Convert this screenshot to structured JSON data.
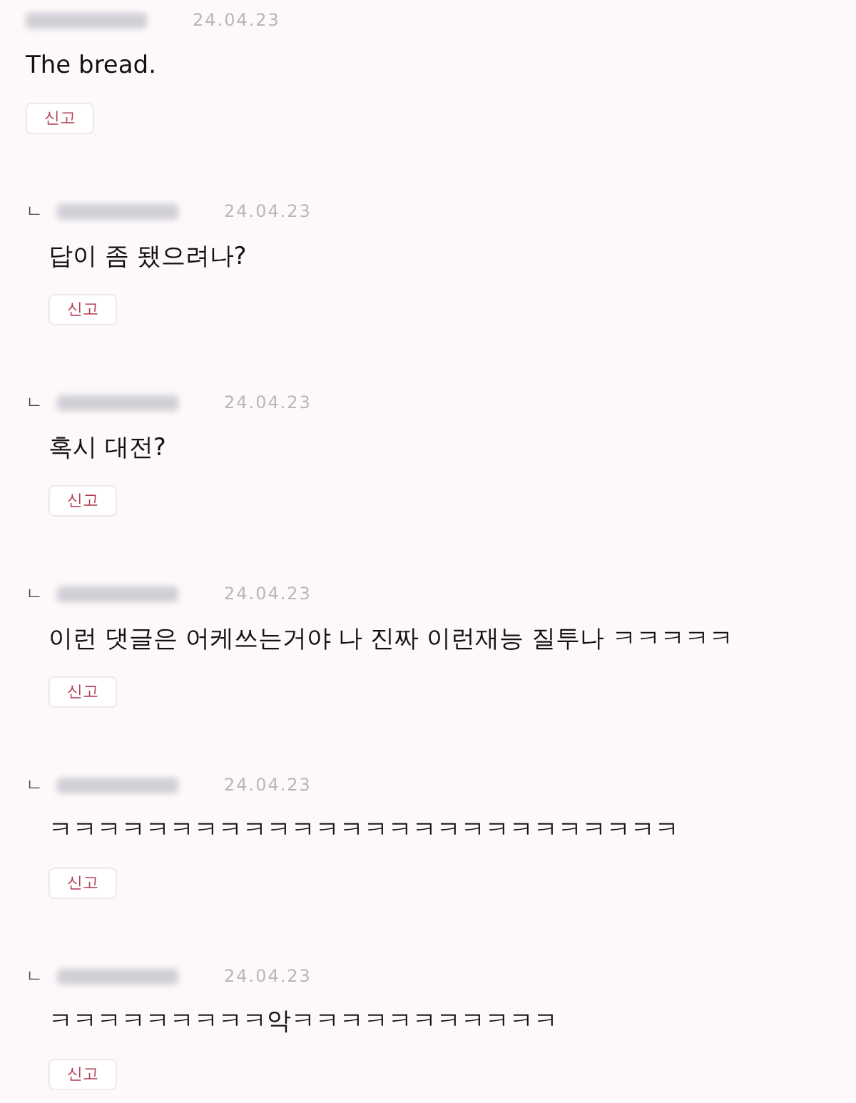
{
  "comments": [
    {
      "kind": "comment",
      "date": "24.04.23",
      "text": "The bread.",
      "report": "신고"
    },
    {
      "kind": "reply",
      "marker": "ㄴ",
      "date": "24.04.23",
      "text": "답이 좀 됐으려나?",
      "report": "신고"
    },
    {
      "kind": "reply",
      "marker": "ㄴ",
      "date": "24.04.23",
      "text": "혹시 대전?",
      "report": "신고"
    },
    {
      "kind": "reply",
      "marker": "ㄴ",
      "date": "24.04.23",
      "text": "이런 댓글은 어케쓰는거야 나 진짜 이런재능 질투나 ㅋㅋㅋㅋㅋ",
      "report": "신고"
    },
    {
      "kind": "reply",
      "marker": "ㄴ",
      "date": "24.04.23",
      "text": "ㅋㅋㅋㅋㅋㅋㅋㅋㅋㅋㅋㅋㅋㅋㅋㅋㅋㅋㅋㅋㅋㅋㅋㅋㅋㅋ",
      "report": "신고"
    },
    {
      "kind": "reply",
      "marker": "ㄴ",
      "date": "24.04.23",
      "text": "ㅋㅋㅋㅋㅋㅋㅋㅋㅋ악ㅋㅋㅋㅋㅋㅋㅋㅋㅋㅋㅋ",
      "report": "신고"
    }
  ]
}
